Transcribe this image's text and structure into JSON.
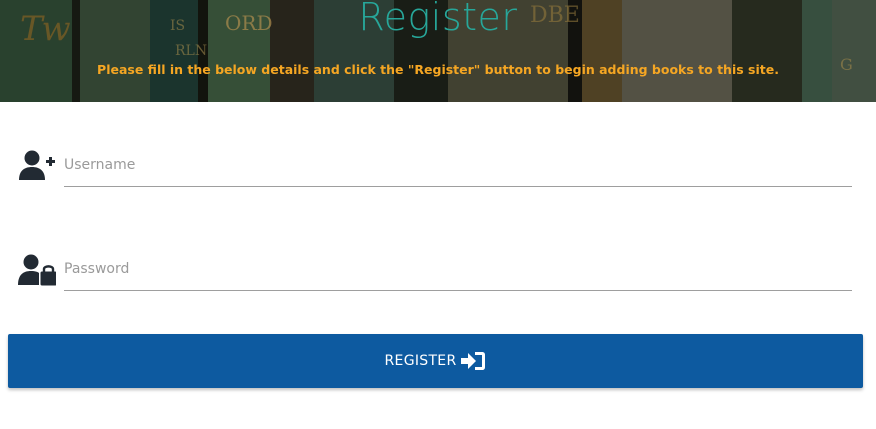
{
  "hero": {
    "title": "Register",
    "subtitle": "Please fill in the below details and click the \"Register\" button to begin adding books to this site."
  },
  "form": {
    "username": {
      "placeholder": "Username",
      "value": "",
      "icon": "user-plus-icon"
    },
    "password": {
      "placeholder": "Password",
      "value": "",
      "icon": "user-lock-icon"
    },
    "submit": {
      "label": "Register",
      "icon": "sign-in-icon"
    }
  },
  "colors": {
    "title": "#27a79a",
    "subtitle": "#f5a623",
    "button": "#0d5aa0",
    "icon": "#222a33"
  }
}
